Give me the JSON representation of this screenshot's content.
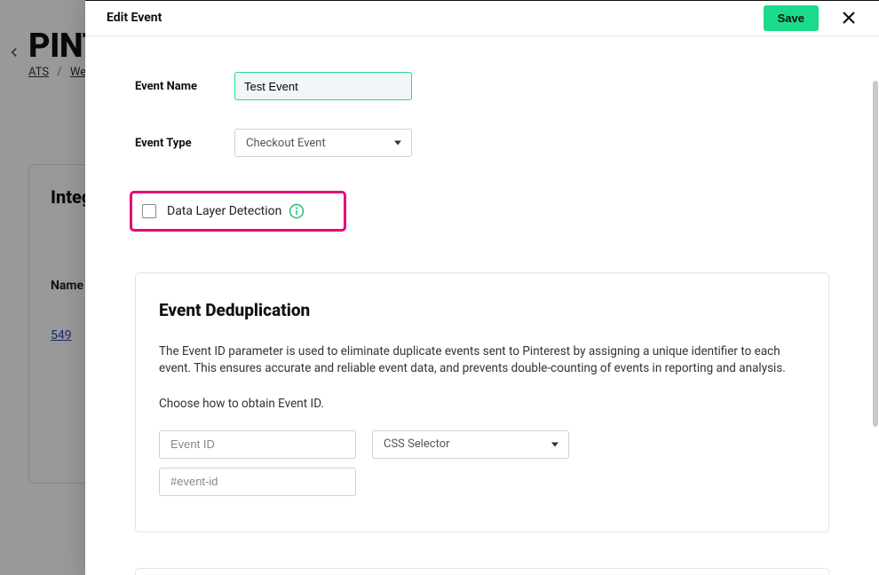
{
  "background": {
    "title": "PINTEREST",
    "breadcrumbs": {
      "first": "ATS",
      "second": "Website"
    },
    "box_heading": "Integrations",
    "label_name": "Name",
    "link_text": "549"
  },
  "modal": {
    "title": "Edit Event",
    "save_label": "Save"
  },
  "form": {
    "event_name_label": "Event Name",
    "event_name_value": "Test Event",
    "event_type_label": "Event Type",
    "event_type_value": "Checkout Event",
    "dld_label": "Data Layer Detection"
  },
  "dedupe": {
    "heading": "Event Deduplication",
    "description": "The Event ID parameter is used to eliminate duplicate events sent to Pinterest by assigning a unique identifier to each event. This ensures accurate and reliable event data, and prevents double-counting of events in reporting and analysis.",
    "prompt": "Choose how to obtain Event ID.",
    "event_id_placeholder": "Event ID",
    "css_selector_label": "CSS Selector",
    "selector_value_placeholder": "#event-id"
  }
}
